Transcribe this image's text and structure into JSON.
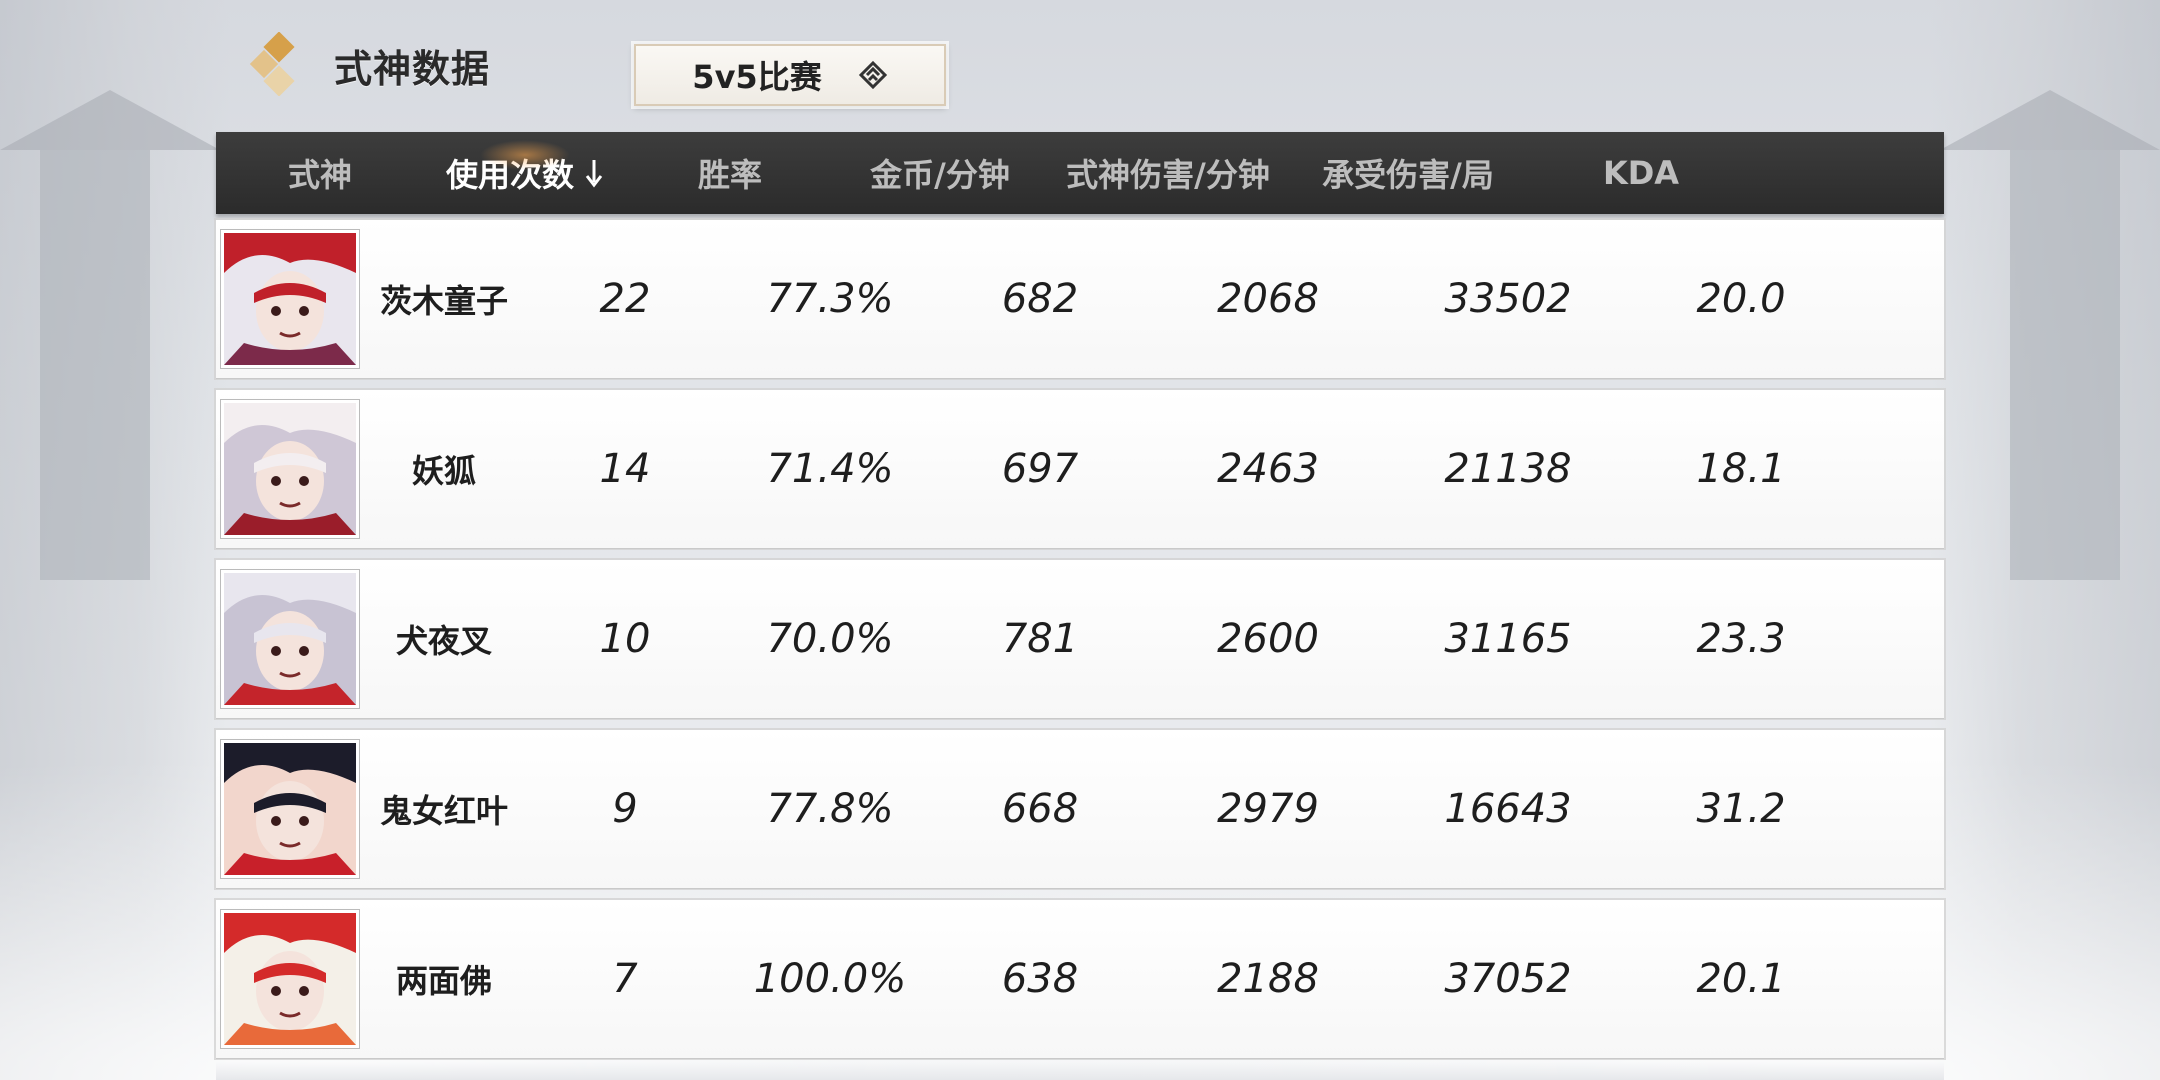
{
  "header": {
    "title": "式神数据",
    "mode_label": "5v5比赛"
  },
  "table": {
    "columns": [
      "式神",
      "使用次数",
      "胜率",
      "金币/分钟",
      "式神伤害/分钟",
      "承受伤害/局",
      "KDA"
    ],
    "sorted_column": "使用次数",
    "sort_direction": "desc",
    "rows": [
      {
        "name": "茨木童子",
        "uses": "22",
        "win_rate": "77.3%",
        "gold_per_min": "682",
        "damage_per_min": "2068",
        "taken_per_game": "33502",
        "kda": "20.0",
        "avatar_colors": [
          "#c0202a",
          "#e9e6ee",
          "#7c2a4a"
        ]
      },
      {
        "name": "妖狐",
        "uses": "14",
        "win_rate": "71.4%",
        "gold_per_min": "697",
        "damage_per_min": "2463",
        "taken_per_game": "21138",
        "kda": "18.1",
        "avatar_colors": [
          "#f3eef0",
          "#cfc7d6",
          "#9a1d2a"
        ]
      },
      {
        "name": "犬夜叉",
        "uses": "10",
        "win_rate": "70.0%",
        "gold_per_min": "781",
        "damage_per_min": "2600",
        "taken_per_game": "31165",
        "kda": "23.3",
        "avatar_colors": [
          "#e8e6ee",
          "#c8c3d3",
          "#c4242b"
        ]
      },
      {
        "name": "鬼女红叶",
        "uses": "9",
        "win_rate": "77.8%",
        "gold_per_min": "668",
        "damage_per_min": "2979",
        "taken_per_game": "16643",
        "kda": "31.2",
        "avatar_colors": [
          "#1c1c2a",
          "#f2d6cc",
          "#c8202a"
        ]
      },
      {
        "name": "两面佛",
        "uses": "7",
        "win_rate": "100.0%",
        "gold_per_min": "638",
        "damage_per_min": "2188",
        "taken_per_game": "37052",
        "kda": "20.1",
        "avatar_colors": [
          "#d42a2a",
          "#f4f0e8",
          "#e86a3a"
        ]
      }
    ]
  }
}
